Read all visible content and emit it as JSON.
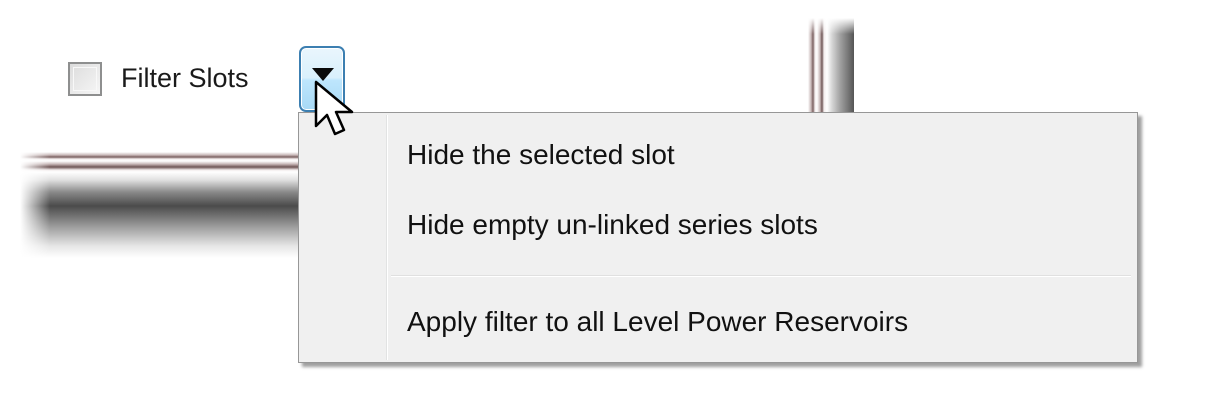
{
  "toolbar": {
    "filter_label": "Filter Slots",
    "filter_checked": false
  },
  "menu": {
    "items": [
      {
        "label": "Hide the selected slot"
      },
      {
        "label": "Hide empty un-linked series slots"
      },
      {
        "label": "Apply filter to all Level Power Reservoirs"
      }
    ]
  },
  "icons": {
    "dropdown": "chevron-down-icon",
    "cursor": "mouse-cursor-icon"
  },
  "colors": {
    "hover_border": "#3c7fb1",
    "menu_background": "#f0f0f0"
  }
}
